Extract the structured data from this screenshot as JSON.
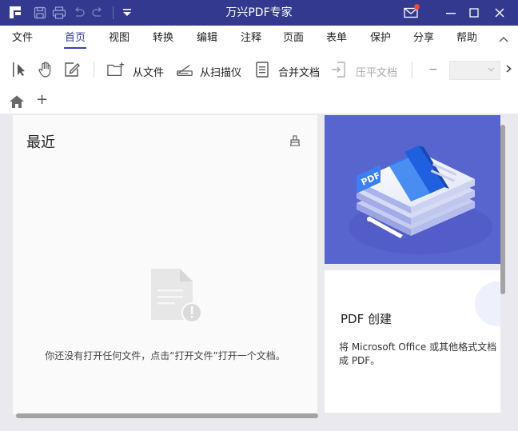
{
  "app": {
    "title": "万兴PDF专家",
    "colors": {
      "titlebar": "#33398f",
      "accent": "#3a45b0",
      "banner": "#5965cf"
    }
  },
  "quick_access": {
    "icons": [
      "save-icon",
      "print-icon",
      "undo-icon",
      "redo-icon",
      "customize-dropdown-icon"
    ]
  },
  "window_controls": {
    "icons": [
      "mail-icon",
      "minimize-icon",
      "maximize-icon",
      "close-icon"
    ]
  },
  "menu": {
    "items": [
      {
        "label": "文件",
        "active": false
      },
      {
        "label": "首页",
        "active": true
      },
      {
        "label": "视图",
        "active": false
      },
      {
        "label": "转换",
        "active": false
      },
      {
        "label": "编辑",
        "active": false
      },
      {
        "label": "注释",
        "active": false
      },
      {
        "label": "页面",
        "active": false
      },
      {
        "label": "表单",
        "active": false
      },
      {
        "label": "保护",
        "active": false
      },
      {
        "label": "分享",
        "active": false
      },
      {
        "label": "帮助",
        "active": false
      }
    ]
  },
  "toolbar": {
    "tools": [
      "select-icon",
      "hand-icon",
      "edit-icon"
    ],
    "from_file": "从文件",
    "from_scanner": "从扫描仪",
    "merge": "合并文档",
    "compress": "压平文档",
    "zoom_minus": "−"
  },
  "tabs": {
    "add": "+"
  },
  "recent": {
    "title": "最近",
    "empty_message": "你还没有打开任何文件，点击“打开文件”打开一个文档。"
  },
  "feature_card": {
    "title": "PDF 创建",
    "desc_line1": "将 Microsoft Office 或其他格式文档",
    "desc_line2": "成 PDF。"
  },
  "banner": {
    "badge": "PDF"
  }
}
